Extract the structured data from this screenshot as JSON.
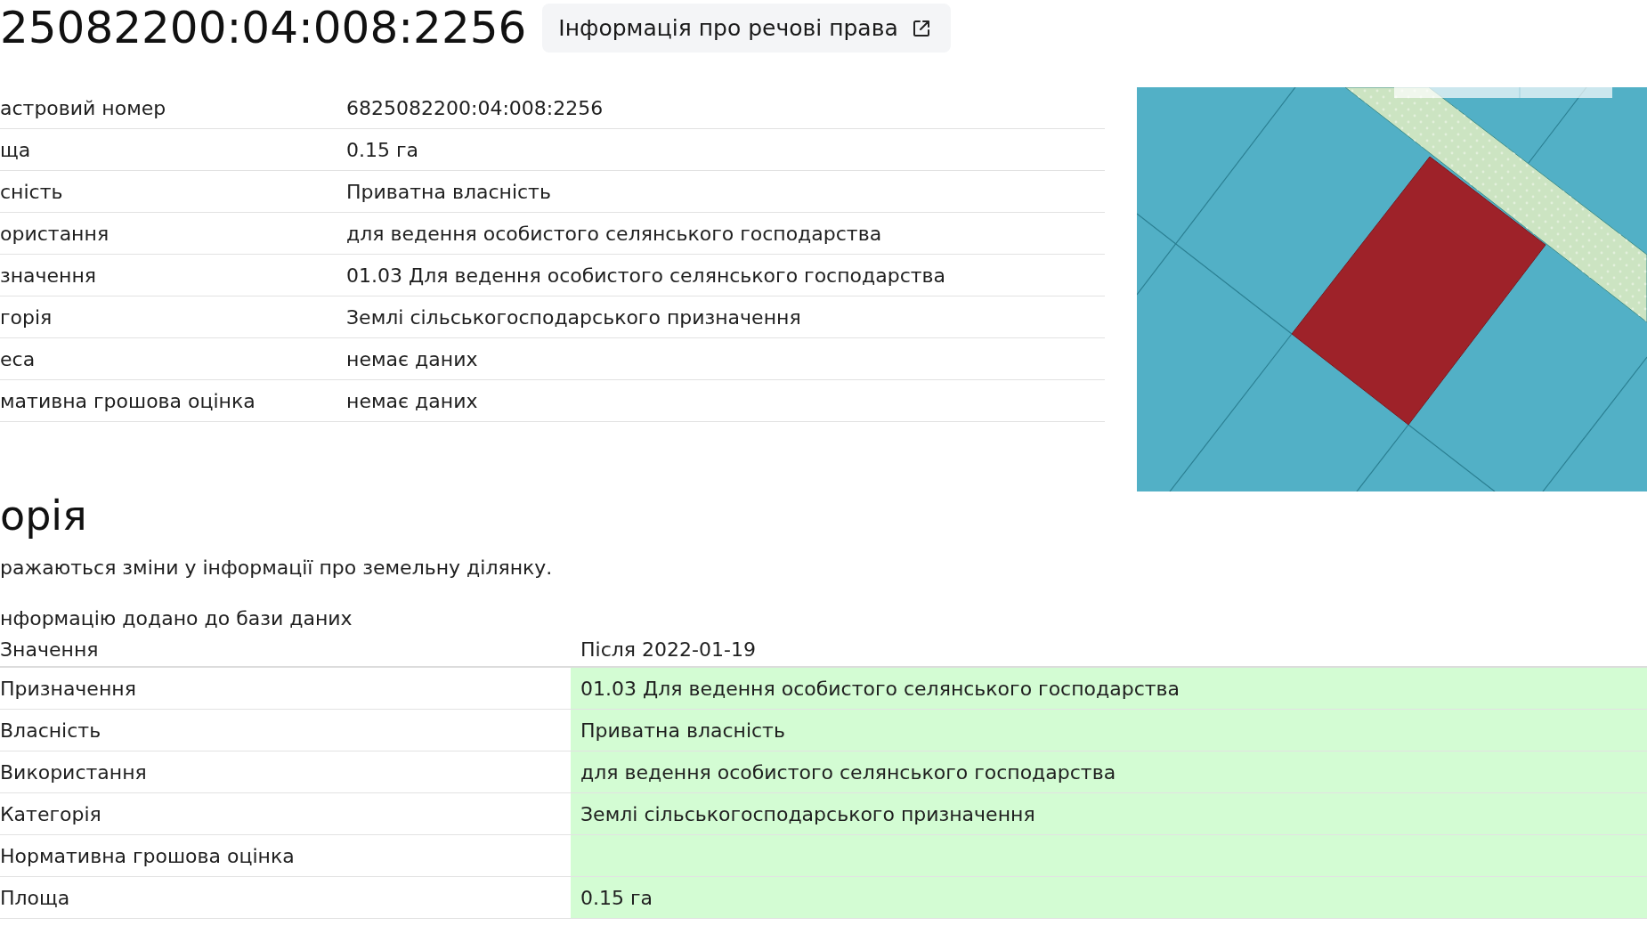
{
  "header": {
    "parcel_number": "25082200:04:008:2256",
    "rights_button": "Інформація про речові права"
  },
  "details": [
    {
      "label": "астровий номер",
      "value": "6825082200:04:008:2256"
    },
    {
      "label": "ща",
      "value": "0.15 га"
    },
    {
      "label": "сність",
      "value": "Приватна власність"
    },
    {
      "label": "ористання",
      "value": "для ведення особистого селянського господарства"
    },
    {
      "label": "значення",
      "value": "01.03 Для ведення особистого селянського господарства"
    },
    {
      "label": "горія",
      "value": "Землі сільськогосподарського призначення"
    },
    {
      "label": "еса",
      "value": "немає даних"
    },
    {
      "label": "мативна грошова оцінка",
      "value": "немає даних"
    }
  ],
  "history": {
    "title": "орія",
    "description": "ражаються зміни у інформації про земельну ділянку.",
    "entry_caption": "нформацію додано до бази даних",
    "columns": [
      "Значення",
      "Після 2022-01-19"
    ],
    "rows": [
      {
        "label": "Призначення",
        "value": "01.03 Для ведення особистого селянського господарства",
        "changed": true
      },
      {
        "label": "Власність",
        "value": "Приватна власність",
        "changed": true
      },
      {
        "label": "Використання",
        "value": "для ведення особистого селянського господарства",
        "changed": true
      },
      {
        "label": "Категорія",
        "value": "Землі сільськогосподарського призначення",
        "changed": true
      },
      {
        "label": "Нормативна грошова оцінка",
        "changed": true
      },
      {
        "label": "Площа",
        "value": "0.15 га",
        "changed": true
      }
    ]
  }
}
